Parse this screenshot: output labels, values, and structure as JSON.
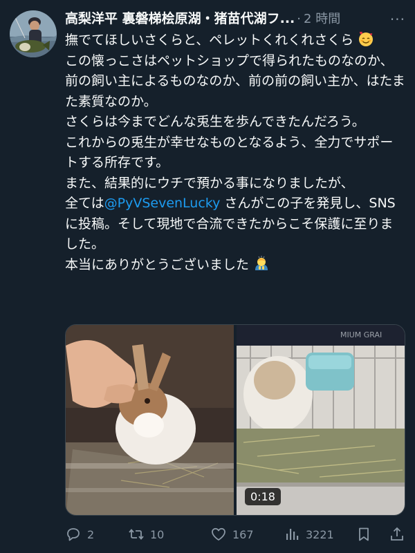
{
  "author": {
    "display_name": "高梨洋平 裏磐梯桧原湖・猪苗代湖フ...",
    "separator": "·",
    "time": "2 時間"
  },
  "more_label": "···",
  "tweet": {
    "line1": "撫でてほしいさくらと、ペレットくれくれさくら",
    "para2": "この懐っこさはペットショップで得られたものなのか、前の飼い主によるものなのか、前の前の飼い主か、はたまた素質なのか。",
    "para3": "さくらは今までどんな兎生を歩んできたんだろう。",
    "para4": "これからの兎生が幸せなものとなるよう、全力でサポートする所存です。",
    "para5": "また、結果的にウチで預かる事になりましたが、",
    "para6_prefix": "全ては",
    "mention": "@PyVSevenLucky",
    "para6_suffix": " さんがこの子を発見し、SNSに投稿。そして現地で合流できたからこそ保護に至りました。",
    "para7": "本当にありがとうございました"
  },
  "emojis": {
    "smiling_face_hearts": "smiling-face-with-hearts-icon",
    "bowing_person": "person-bowing-icon"
  },
  "media": {
    "video_duration": "0:18"
  },
  "actions": {
    "replies": "2",
    "retweets": "10",
    "likes": "167",
    "views": "3221"
  },
  "colors": {
    "background": "#15202b",
    "text": "#f7f9f9",
    "secondary": "#8b98a5",
    "mention": "#1d9bf0"
  }
}
